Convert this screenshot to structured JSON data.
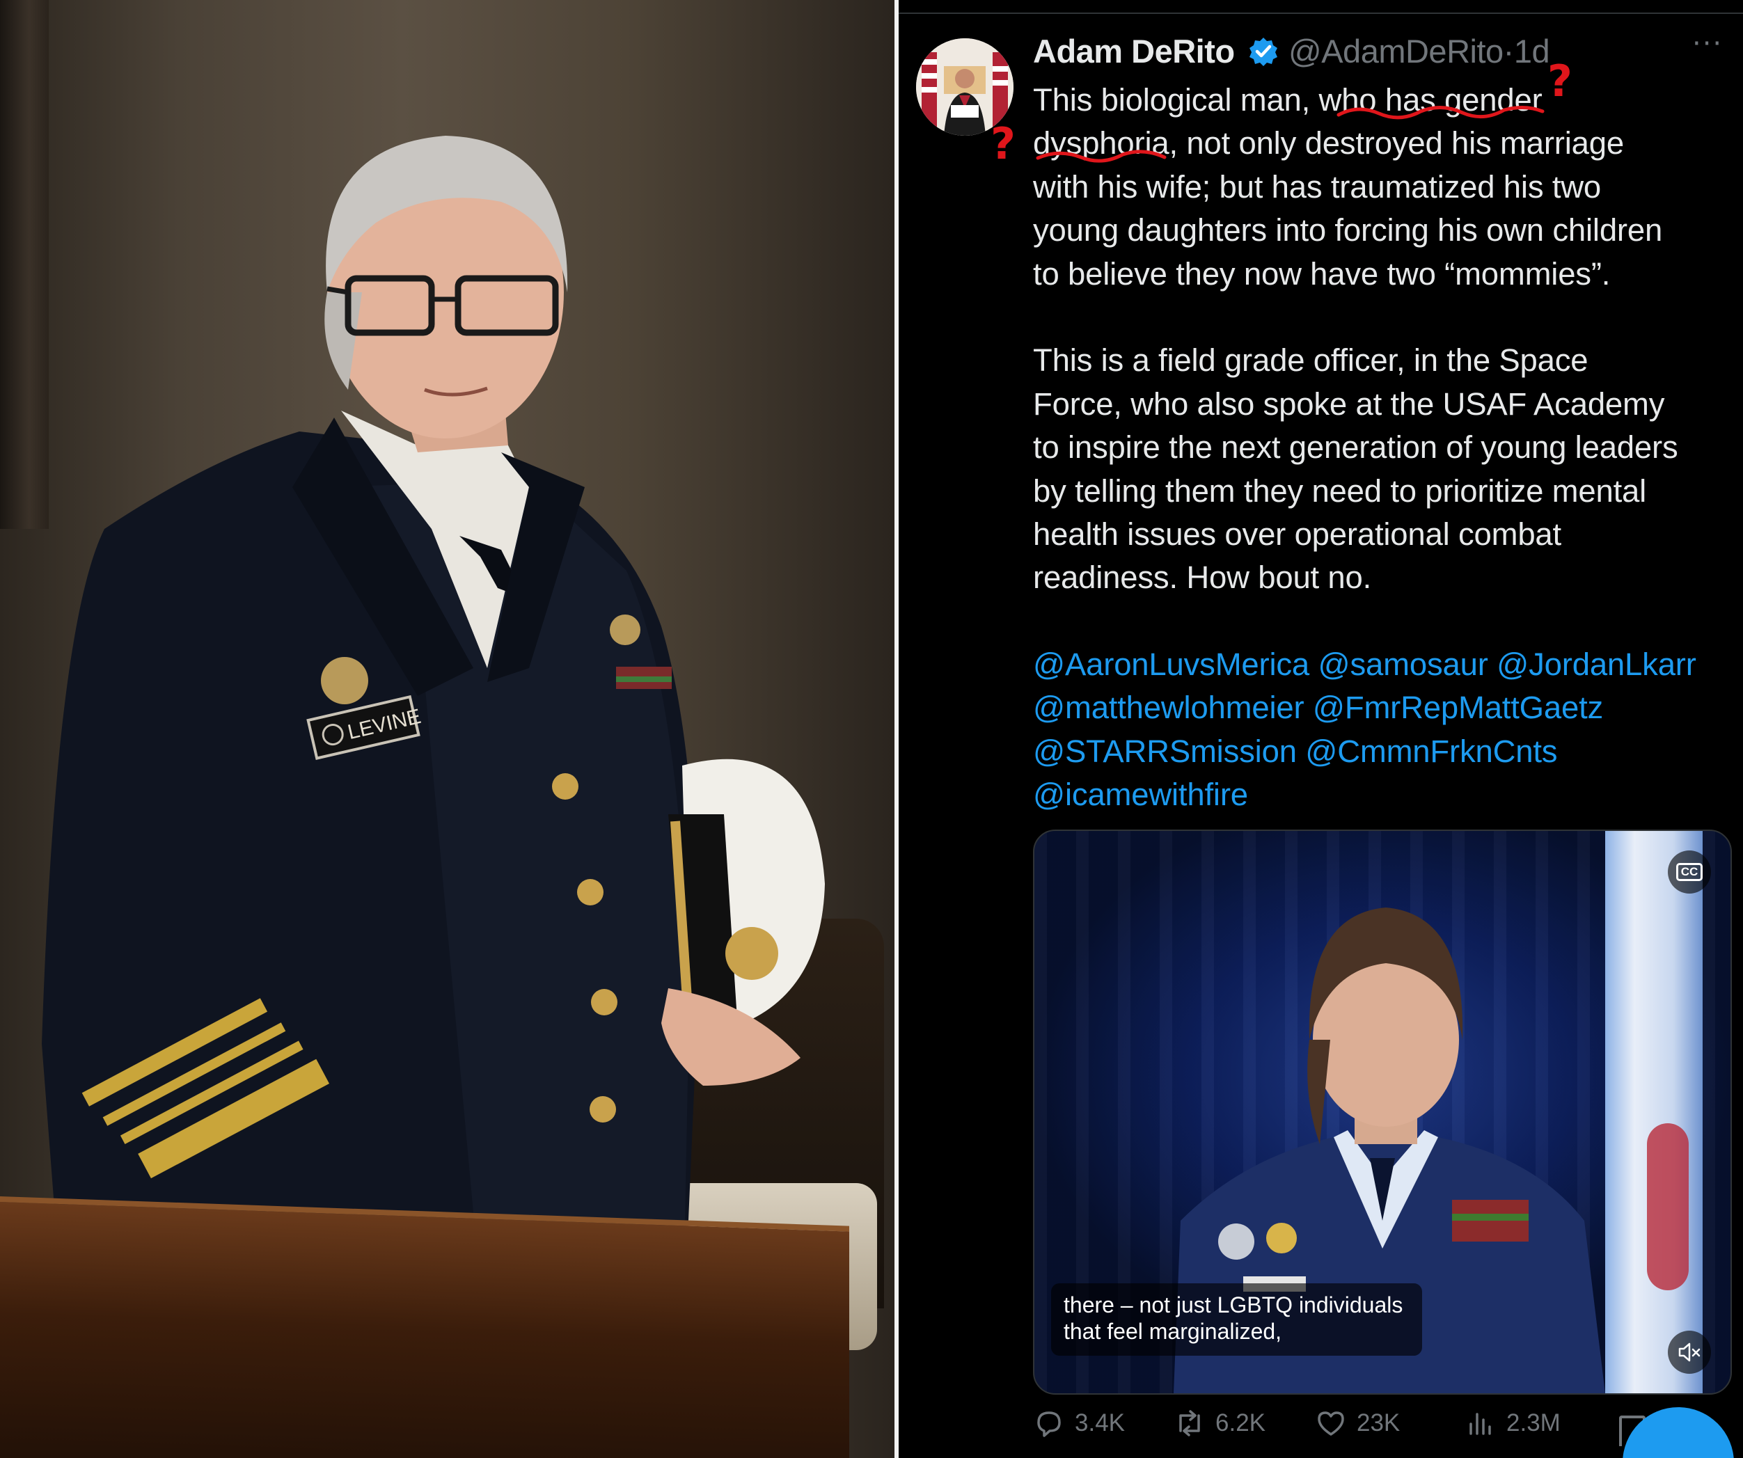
{
  "photo": {
    "nameplate_text": "LEVINE"
  },
  "tweet": {
    "author_name": "Adam DeRito",
    "handle": "@AdamDeRito",
    "separator": "·",
    "time_ago": "1d",
    "more_label": "···",
    "body_lines": [
      {
        "segments": [
          {
            "text": "This biological man, "
          },
          {
            "text": "who has gender"
          }
        ]
      },
      {
        "segments": [
          {
            "text": "dysphoria"
          },
          {
            "text": ", not only destroyed his marriage"
          }
        ]
      },
      {
        "segments": [
          {
            "text": "with his wife; but has traumatized his two"
          }
        ]
      },
      {
        "segments": [
          {
            "text": "young daughters into forcing his own children"
          }
        ]
      },
      {
        "segments": [
          {
            "text": "to believe they now have two “mommies”."
          }
        ]
      }
    ],
    "body_lines_2": [
      "This is a field grade officer, in the Space",
      "Force, who also spoke at the USAF Academy",
      "to inspire the next generation of young leaders",
      "by telling them they need to prioritize mental",
      "health issues over operational combat",
      "readiness. How bout no."
    ],
    "mentions_lines": [
      [
        "@AaronLuvsMerica",
        "@samosaur",
        "@JordanLkarr"
      ],
      [
        "@matthewlohmeier",
        "@FmrRepMattGaetz"
      ],
      [
        "@STARRSmission",
        "@CmmnFrknCnts"
      ],
      [
        "@icamewithfire"
      ]
    ],
    "video": {
      "cc_label": "CC",
      "caption_lines": [
        "there – not just LGBTQ individuals",
        "that feel marginalized,"
      ]
    },
    "actions": {
      "replies": "3.4K",
      "reposts": "6.2K",
      "likes": "23K",
      "views": "2.3M"
    },
    "annotation": {
      "color": "#e0161b",
      "mark": "?"
    },
    "colors": {
      "background": "#000000",
      "text": "#e7e9ea",
      "muted": "#71767b",
      "link": "#1d9bf0"
    }
  }
}
